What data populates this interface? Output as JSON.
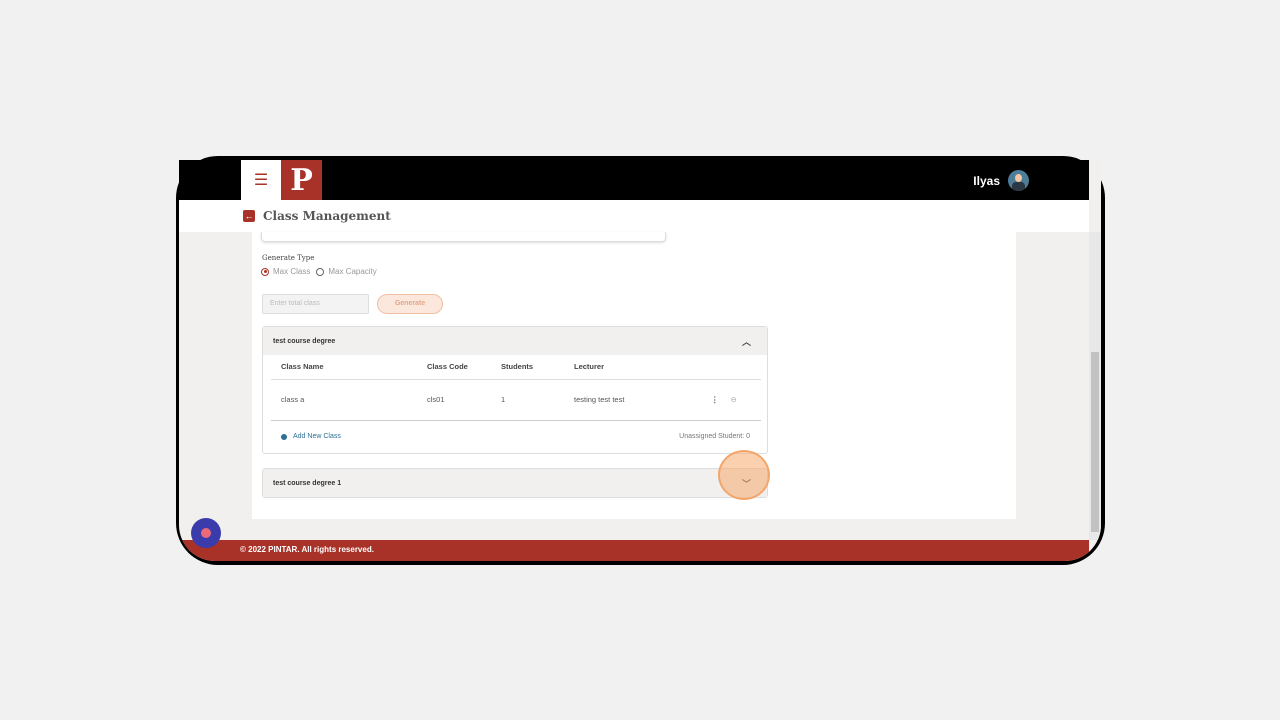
{
  "header": {
    "menu_icon": "hamburger-icon",
    "logo": "P",
    "user_name": "Ilyas"
  },
  "page": {
    "title": "Class Management"
  },
  "form": {
    "generate_type_label": "Generate Type",
    "options": [
      "Max Class",
      "Max Capacity"
    ],
    "selected": "Max Class",
    "total_class_placeholder": "Enter total class",
    "generate_label": "Generate"
  },
  "courses": [
    {
      "name": "test course degree",
      "expanded": true,
      "columns": [
        "Class Name",
        "Class Code",
        "Students",
        "Lecturer"
      ],
      "rows": [
        {
          "name": "class a",
          "code": "cls01",
          "students": "1",
          "lecturer": "testing test test"
        }
      ],
      "add_label": "Add New Class",
      "unassigned": "Unassigned Student: 0"
    },
    {
      "name": "test course degree 1",
      "expanded": false
    }
  ],
  "footer": {
    "text": "© 2022 PINTAR. All rights reserved."
  },
  "colors": {
    "brand": "#a83228",
    "link": "#2d6f95"
  }
}
